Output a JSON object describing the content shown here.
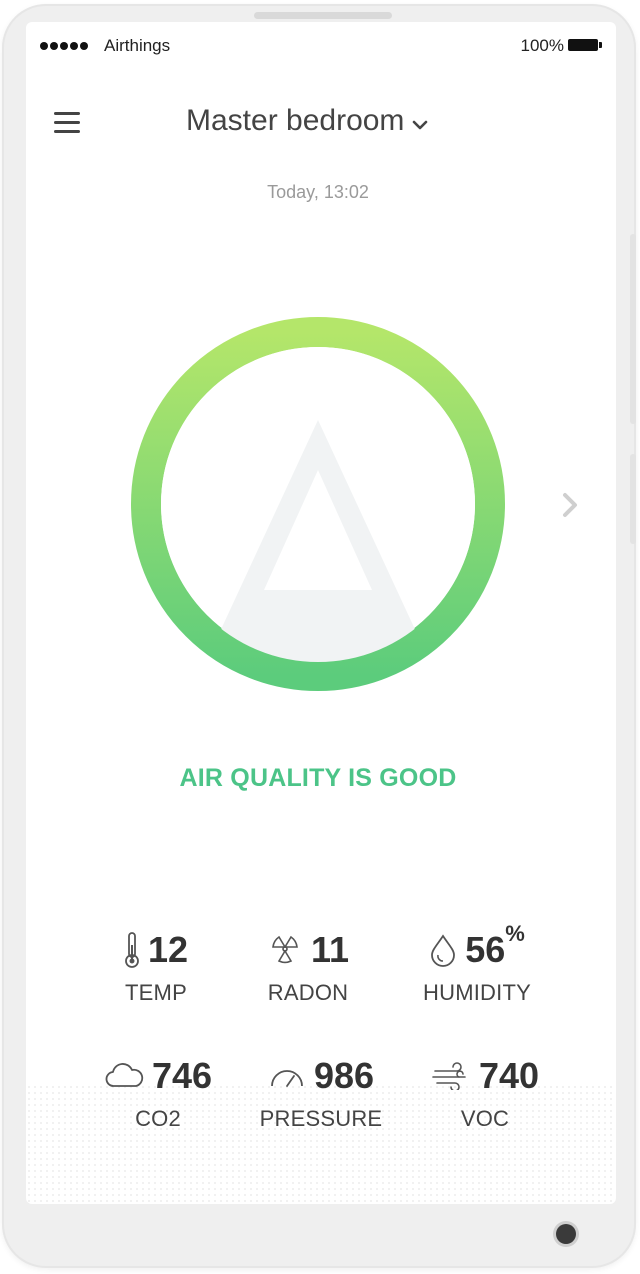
{
  "status_bar": {
    "carrier": "Airthings",
    "battery": "100%"
  },
  "header": {
    "room": "Master bedroom",
    "timestamp": "Today, 13:02"
  },
  "air_quality": {
    "status_text": "AIR QUALITY IS GOOD",
    "status_color": "#4cc488",
    "ring_gradient": [
      "#b4e66a",
      "#5ccc7c"
    ]
  },
  "metrics": [
    {
      "icon": "thermometer-icon",
      "value": "12",
      "unit": "",
      "label": "TEMP"
    },
    {
      "icon": "radon-icon",
      "value": "11",
      "unit": "",
      "label": "RADON"
    },
    {
      "icon": "humidity-drop-icon",
      "value": "56",
      "unit": "%",
      "label": "HUMIDITY"
    },
    {
      "icon": "cloud-icon",
      "value": "746",
      "unit": "",
      "label": "CO2"
    },
    {
      "icon": "gauge-icon",
      "value": "986",
      "unit": "",
      "label": "PRESSURE"
    },
    {
      "icon": "wind-icon",
      "value": "740",
      "unit": "",
      "label": "VOC"
    }
  ]
}
